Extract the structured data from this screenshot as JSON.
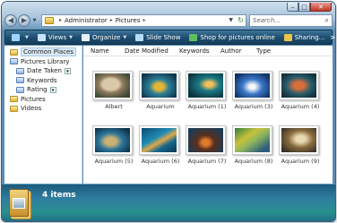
{
  "window": {
    "caption_buttons": {
      "minimize": "–",
      "maximize": "□",
      "close": "✕"
    }
  },
  "address": {
    "back_glyph": "◀",
    "forward_glyph": "▶",
    "crumbs": [
      "Administrator",
      "Pictures"
    ],
    "separator": "▸",
    "dropdown_glyph": "▼",
    "refresh_glyph": "↻"
  },
  "search": {
    "placeholder": "Search...",
    "value": "",
    "icon": "search-icon",
    "icon_glyph": "⌕"
  },
  "toolbar": {
    "items": [
      {
        "label": "",
        "icon": "organize-folder-icon",
        "color": "#9fd3ff"
      },
      {
        "label": "Views",
        "icon": "views-icon",
        "color": "#c9e3ff"
      },
      {
        "label": "Organize",
        "icon": "organize-icon",
        "color": "#e8f1fb"
      },
      {
        "label": "Slide Show",
        "icon": "slideshow-icon",
        "color": "#b6dcff"
      },
      {
        "label": "Shop for pictures online",
        "icon": "shop-icon",
        "color": "#5fbf5f"
      },
      {
        "label": "Sharing...",
        "icon": "sharing-icon",
        "color": "#f0c24a"
      }
    ],
    "more": ">>",
    "caret": "▼"
  },
  "nav_pane": {
    "items": [
      {
        "label": "Common Places",
        "icon": "folder-icon",
        "kind": "gold",
        "indent": 0,
        "selected": true,
        "dropdown": false
      },
      {
        "label": "Pictures Library",
        "icon": "folder-icon",
        "kind": "blue",
        "indent": 0,
        "selected": false,
        "dropdown": false
      },
      {
        "label": "Date Taken",
        "icon": "folder-icon",
        "kind": "blue",
        "indent": 1,
        "selected": false,
        "dropdown": true
      },
      {
        "label": "Keywords",
        "icon": "folder-icon",
        "kind": "blue",
        "indent": 1,
        "selected": false,
        "dropdown": false
      },
      {
        "label": "Rating",
        "icon": "folder-icon",
        "kind": "blue",
        "indent": 1,
        "selected": false,
        "dropdown": true
      },
      {
        "label": "Pictures",
        "icon": "folder-icon",
        "kind": "gold",
        "indent": 0,
        "selected": false,
        "dropdown": false
      },
      {
        "label": "Videos",
        "icon": "folder-icon",
        "kind": "gold",
        "indent": 0,
        "selected": false,
        "dropdown": false
      }
    ]
  },
  "columns": [
    "Name",
    "Date Modified",
    "Keywords",
    "Author",
    "Type"
  ],
  "thumbnails": [
    {
      "label": "Albert",
      "image": "albert"
    },
    {
      "label": "Aquarium",
      "image": "aq"
    },
    {
      "label": "Aquarium (1)",
      "image": "aq1"
    },
    {
      "label": "Aquarium (3)",
      "image": "aq3"
    },
    {
      "label": "Aquarium (4)",
      "image": "aq4"
    },
    {
      "label": "Aquarium (5)",
      "image": "aq5"
    },
    {
      "label": "Aquarium (6)",
      "image": "aq6"
    },
    {
      "label": "Aquarium (7)",
      "image": "aq7"
    },
    {
      "label": "Aquarium (8)",
      "image": "aq8"
    },
    {
      "label": "Aquarium (9)",
      "image": "aq9"
    }
  ],
  "details": {
    "item_count": "4 items"
  }
}
